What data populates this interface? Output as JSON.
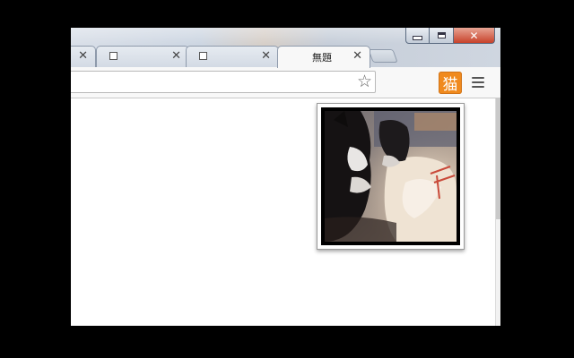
{
  "window": {
    "controls": {
      "minimize_icon": "minimize-icon",
      "maximize_icon": "restore-icon",
      "close_label": "✕"
    }
  },
  "tabs": [
    {
      "title": "",
      "close": "✕",
      "favicon": "blank-page-icon"
    },
    {
      "title": "",
      "close": "✕",
      "favicon": "blank-page-icon"
    },
    {
      "title": "",
      "close": "✕",
      "favicon": "blank-page-icon"
    },
    {
      "title": "無題",
      "close": "✕",
      "active": true
    }
  ],
  "toolbar": {
    "bookmark_star": "☆",
    "extension_label": "猫",
    "extension_color": "#f08a1e",
    "menu_icon": "hamburger-menu-icon"
  },
  "popup": {
    "media": "cat-video-frame"
  }
}
